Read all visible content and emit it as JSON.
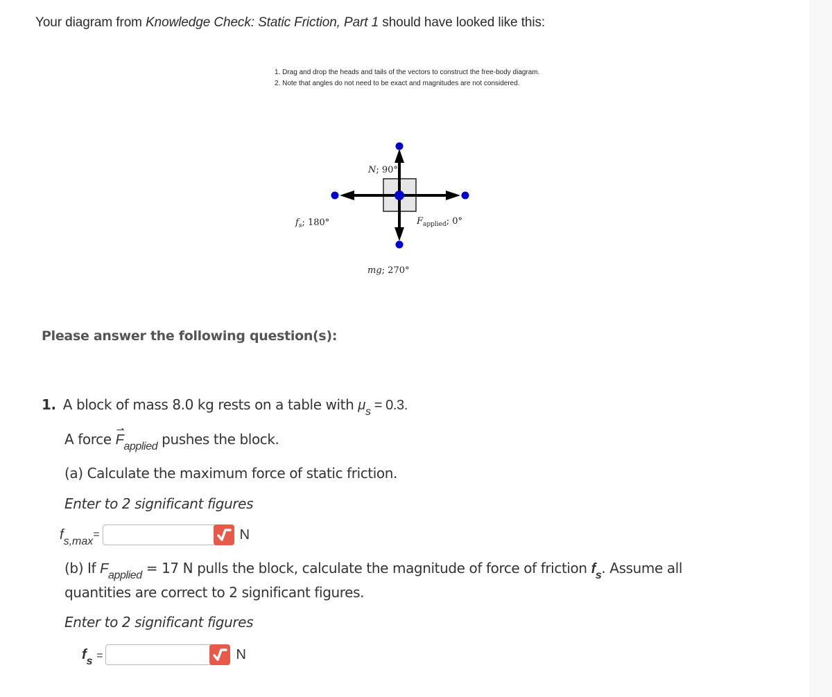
{
  "intro": {
    "prefix": "Your diagram from ",
    "link_title": "Knowledge Check: Static Friction, Part 1",
    "suffix": " should have looked like this:"
  },
  "instructions": [
    "1. Drag and drop the heads and tails of the vectors to construct the free-body diagram.",
    "2. Note that angles do not need to be exact and magnitudes are not considered."
  ],
  "diagram": {
    "vectors": [
      {
        "name": "N",
        "angle_deg": 90,
        "label_main": "N",
        "label_sub": "",
        "label_tail": "; 90°"
      },
      {
        "name": "f_s",
        "angle_deg": 180,
        "label_main": "f",
        "label_sub": "s",
        "label_tail": "; 180°"
      },
      {
        "name": "F_applied",
        "angle_deg": 0,
        "label_main": "F",
        "label_sub": "applied",
        "label_tail": "; 0°"
      },
      {
        "name": "mg",
        "angle_deg": 270,
        "label_main": "mg",
        "label_sub": "",
        "label_tail": "; 270°"
      }
    ],
    "colors": {
      "handle": "#0000cc",
      "block_fill": "#e6e6e6",
      "arrow": "#000000"
    }
  },
  "prompt_heading": "Please answer the following question(s):",
  "question": {
    "number": "1.",
    "line1_text": "A block of mass 8.0 kg rests on a table with ",
    "mu": "μ",
    "mu_sub": "s",
    "line1_tail": " = 0.3.",
    "line2_prefix": "A force ",
    "line2_F": "F",
    "line2_sub": "applied",
    "line2_suffix": " pushes the block.",
    "part_a": {
      "text": "(a) Calculate the maximum force of static friction.",
      "hint": "Enter to 2 significant figures",
      "label_main": "f",
      "label_sub": "s,max",
      "label_eq": "=",
      "value": "",
      "unit": "N"
    },
    "part_b": {
      "text_prefix": "(b) If ",
      "F": "F",
      "F_sub": "applied",
      "text_mid": " = 17 N pulls the block, calculate the magnitude of force of friction ",
      "fs": "f",
      "fs_sub": "s",
      "text_end": ". Assume all",
      "line2": "quantities are correct to 2 significant figures.",
      "hint": "Enter to 2 significant figures",
      "label_main": "f",
      "label_sub": "s",
      "label_eq": "=",
      "value": "",
      "unit": "N"
    }
  },
  "check_button_color": "#e8594a"
}
